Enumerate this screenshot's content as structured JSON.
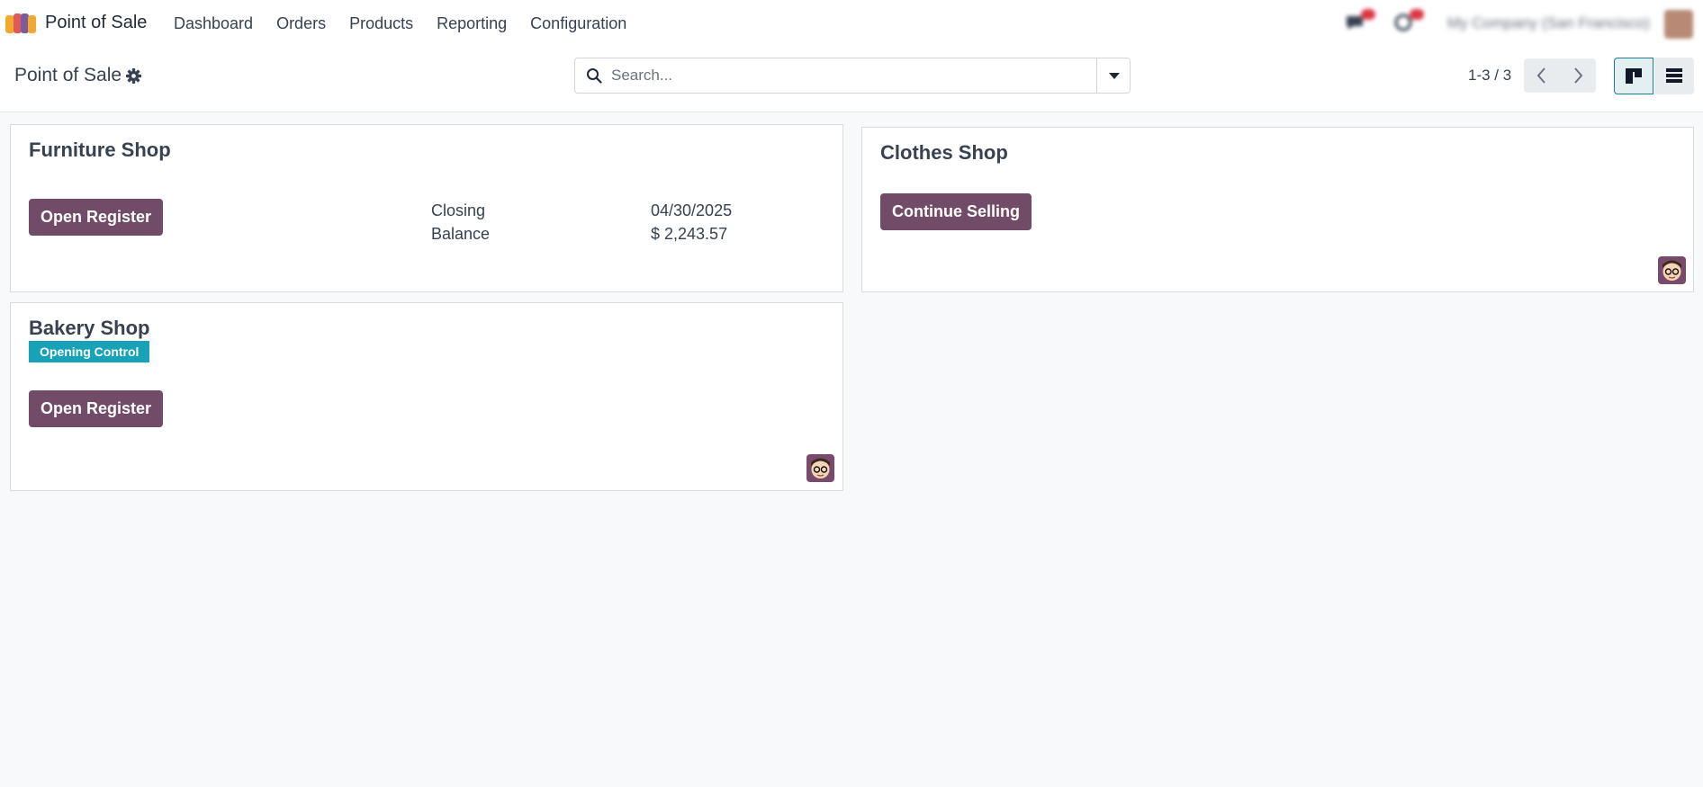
{
  "navbar": {
    "app_name": "Point of Sale",
    "menu": [
      "Dashboard",
      "Orders",
      "Products",
      "Reporting",
      "Configuration"
    ],
    "company_name": "My Company (San Francisco)"
  },
  "control_panel": {
    "breadcrumb": "Point of Sale",
    "search_placeholder": "Search...",
    "pager": "1-3 / 3"
  },
  "cards": [
    {
      "title": "Furniture Shop",
      "button": "Open Register",
      "closing_label": "Closing",
      "closing_value": "04/30/2025",
      "balance_label": "Balance",
      "balance_value": "$ 2,243.57"
    },
    {
      "title": "Clothes Shop",
      "button": "Continue Selling"
    },
    {
      "title": "Bakery Shop",
      "badge": "Opening Control",
      "button": "Open Register"
    }
  ],
  "colors": {
    "primary": "#714b67",
    "badge": "#17a2b8",
    "background": "#f8f9fa"
  },
  "icons": [
    "app-logo-icon",
    "gear-icon",
    "search-icon",
    "caret-down-icon",
    "chevron-left-icon",
    "chevron-right-icon",
    "kanban-view-icon",
    "list-view-icon",
    "messages-icon",
    "activity-icon"
  ]
}
